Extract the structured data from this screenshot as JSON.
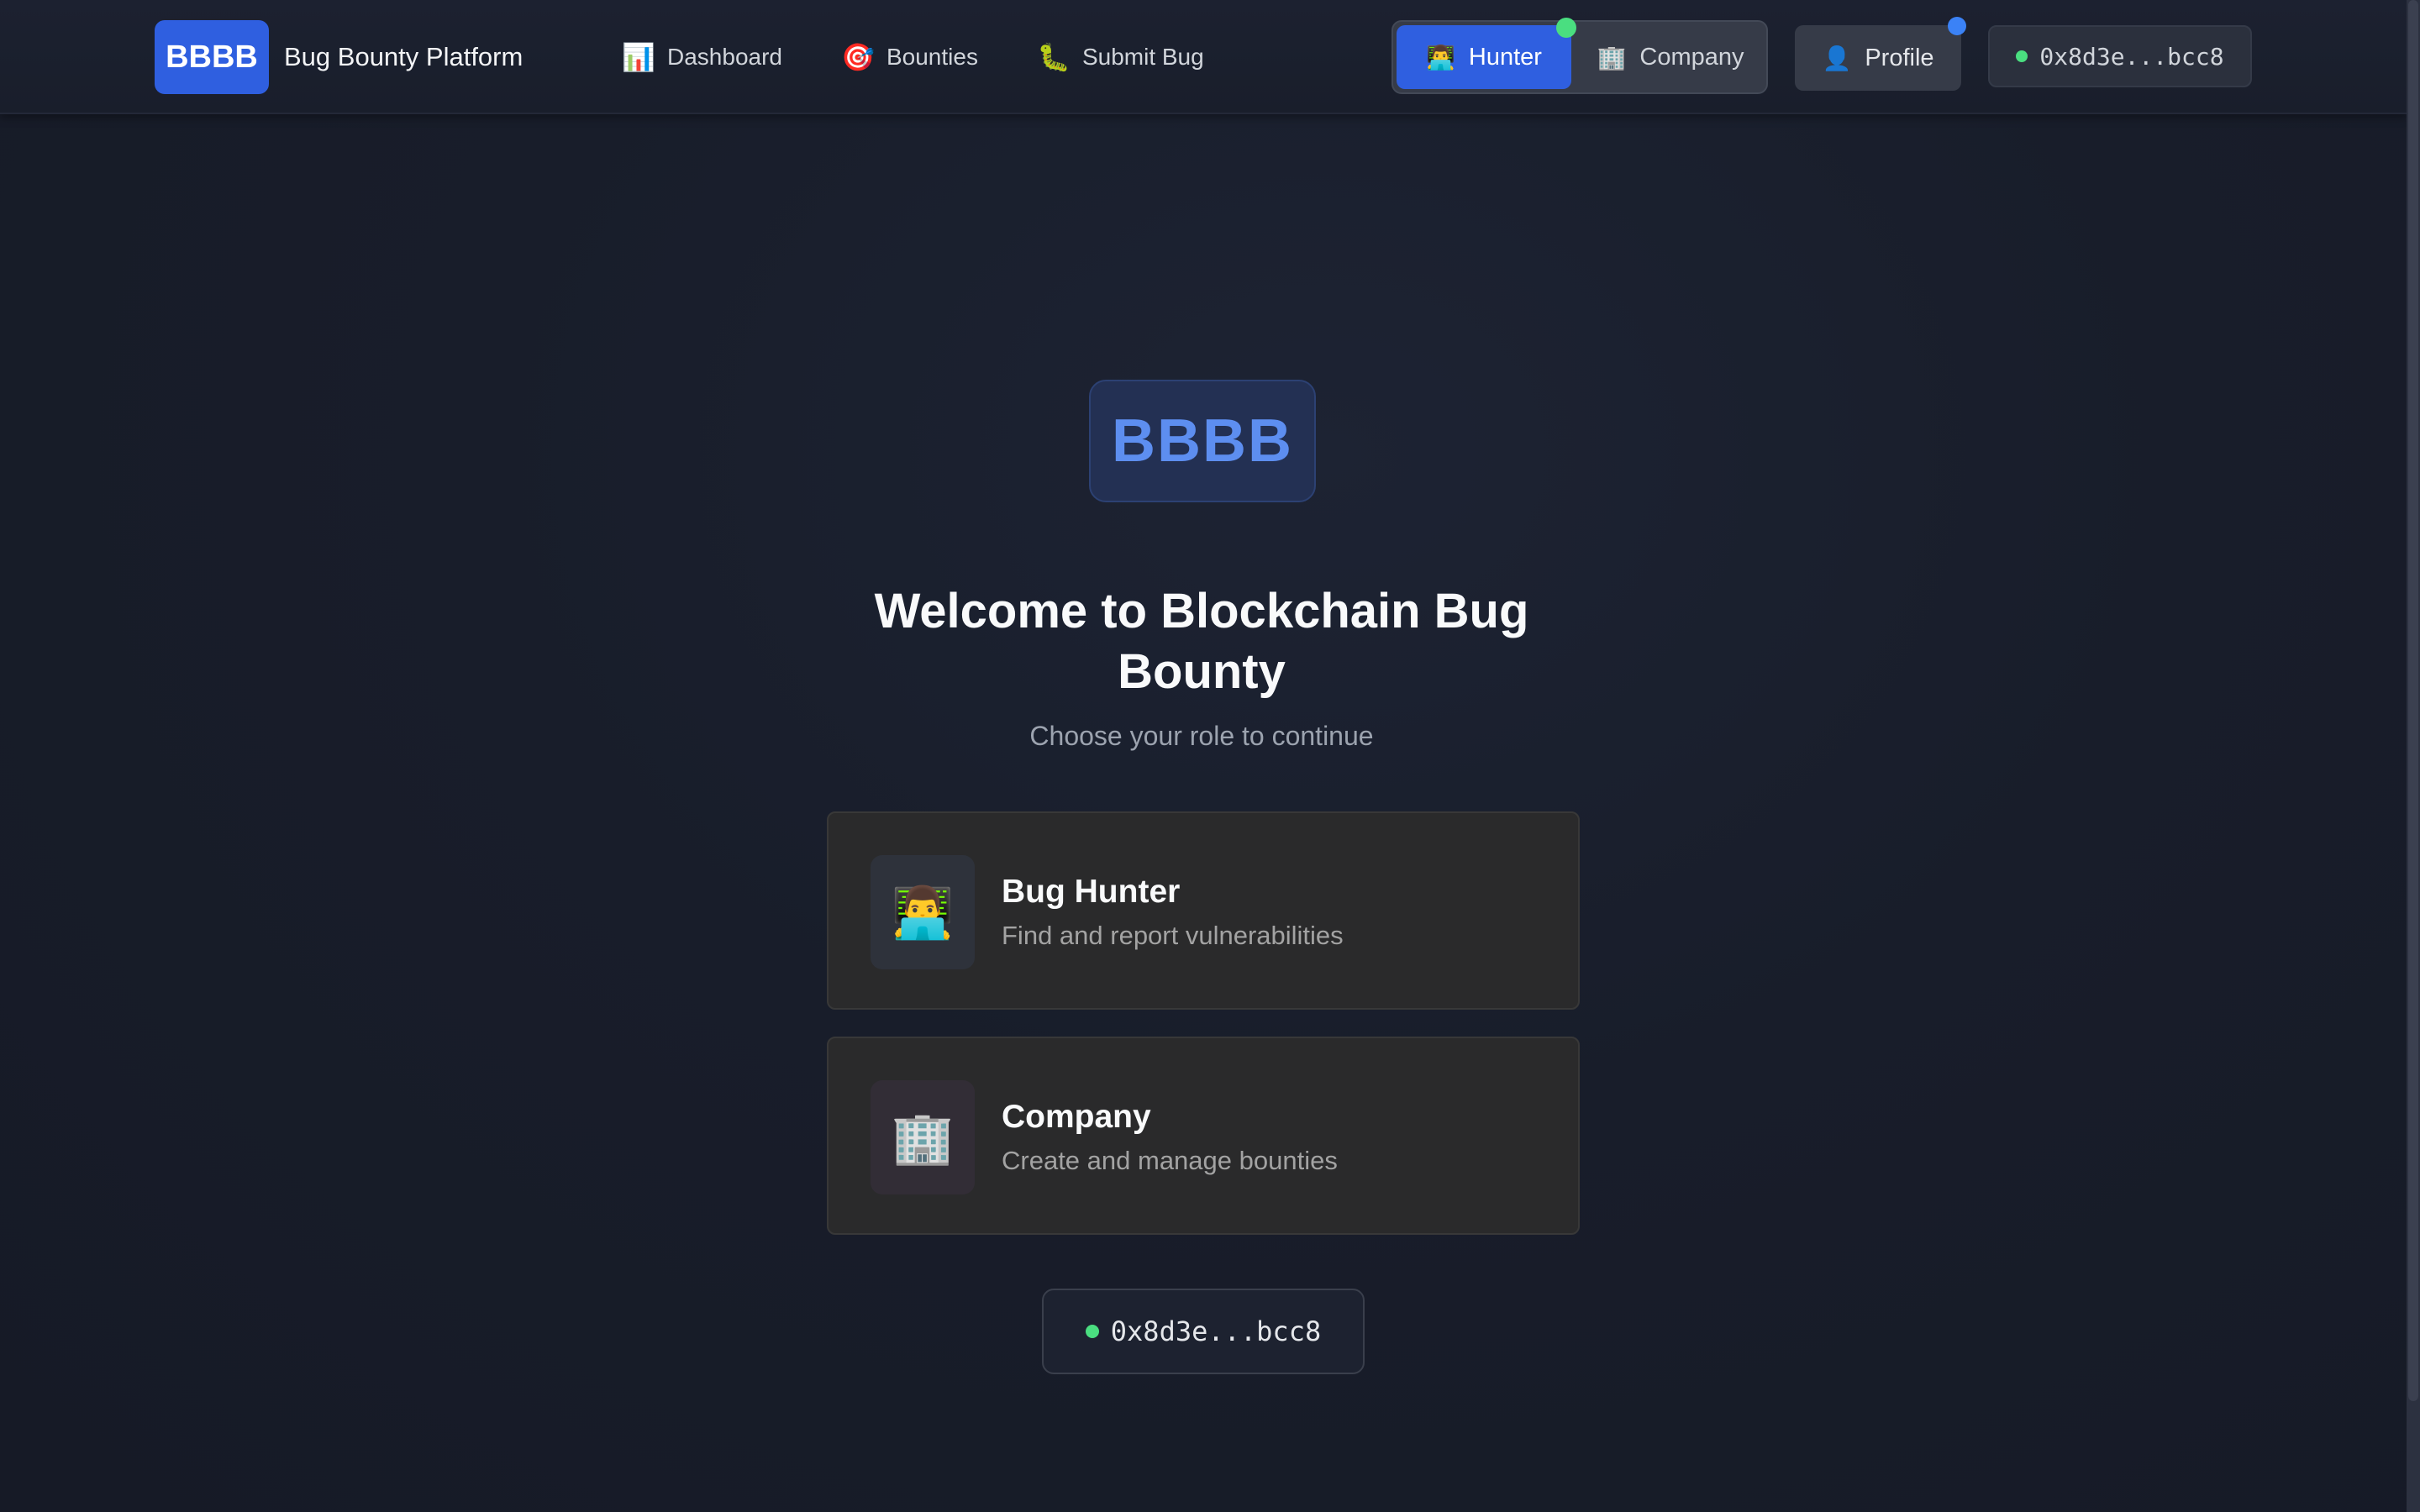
{
  "navbar": {
    "logo_text": "BBBB",
    "brand_name": "Bug Bounty Platform",
    "links": [
      {
        "label": "Dashboard",
        "icon": "📊"
      },
      {
        "label": "Bounties",
        "icon": "🎯"
      },
      {
        "label": "Submit Bug",
        "icon": "🐛"
      }
    ],
    "role_toggle": {
      "hunter_label": "Hunter",
      "hunter_icon": "👨‍💻",
      "company_label": "Company",
      "company_icon": "🏢",
      "active": "Hunter"
    },
    "profile_label": "Profile",
    "profile_icon": "👤",
    "wallet_address": "0x8d3e...bcc8"
  },
  "hero": {
    "logo_text": "BBBB",
    "title": "Welcome to Blockchain Bug Bounty",
    "subtitle": "Choose your role to continue"
  },
  "roles": [
    {
      "icon": "👨‍💻",
      "title": "Bug Hunter",
      "description": "Find and report vulnerabilities"
    },
    {
      "icon": "🏢",
      "title": "Company",
      "description": "Create and manage bounties"
    }
  ],
  "wallet": {
    "address": "0x8d3e...bcc8",
    "status_color": "#4ade80"
  },
  "colors": {
    "accent": "#2f5fe0",
    "connected": "#4ade80",
    "notification": "#3b82f6"
  }
}
